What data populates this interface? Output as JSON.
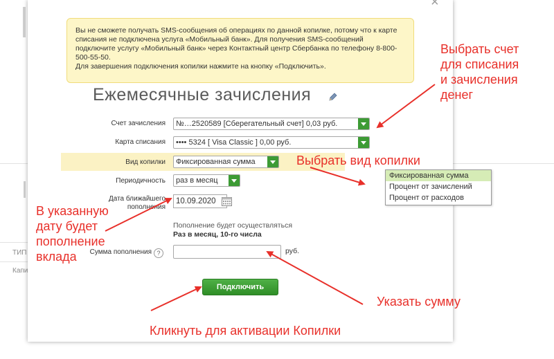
{
  "background": {
    "column_header": "ТИП С",
    "cell": "Капи"
  },
  "modal": {
    "close_label": "×",
    "warning": [
      "Вы не сможете получать SMS-сообщения об операциях по данной копилке, потому что к карте списания не подключена услуга «Мобильный банк». Для получения SMS-сообщений подключите услугу «Мобильный банк» через Контактный центр Сбербанка по телефону 8-800-500-55-50.",
      "Для завершения подключения копилки нажмите на кнопку «Подключить»."
    ],
    "title": "Ежемесячные зачисления",
    "fields": {
      "account_label": "Счет зачисления",
      "account_value": "№…2520589  [Сберегательный счет] 0,03  руб.",
      "card_label": "Карта списания",
      "card_value": "•••• 5324  [ Visa Classic ] 0,00    руб.",
      "type_label": "Вид копилки",
      "type_value": "Фиксированная сумма",
      "period_label": "Периодичность",
      "period_value": "раз в месяц",
      "date_label_1": "Дата ближайшего",
      "date_label_2": "пополнения",
      "date_value": "10.09.2020",
      "info_line": "Пополнение будет осуществляться",
      "info_bold": "Раз в месяц, 10-го числа",
      "amount_label": "Сумма пополнения",
      "help_label": "?",
      "amount_placeholder": "",
      "amount_unit": "руб."
    },
    "connect_button": "Подключить",
    "dropdown_options": [
      "Фиксированная сумма",
      "Процент от зачислений",
      "Процент от расходов"
    ]
  },
  "annotations": {
    "choose_account": [
      "Выбрать счет",
      "для списания",
      "и зачисления",
      "денег"
    ],
    "choose_type": "Выбрать вид копилки",
    "date_note": [
      "В указанную",
      "дату будет",
      "пополнение",
      "вклада"
    ],
    "enter_amount": "Указать сумму",
    "click_activate": "Кликнуть для активации Копилки"
  },
  "colors": {
    "annotation_red": "#e8302a",
    "button_green": "#3d9b35",
    "warning_bg": "#fdf6c8",
    "highlight_row": "#fbf2c4"
  }
}
